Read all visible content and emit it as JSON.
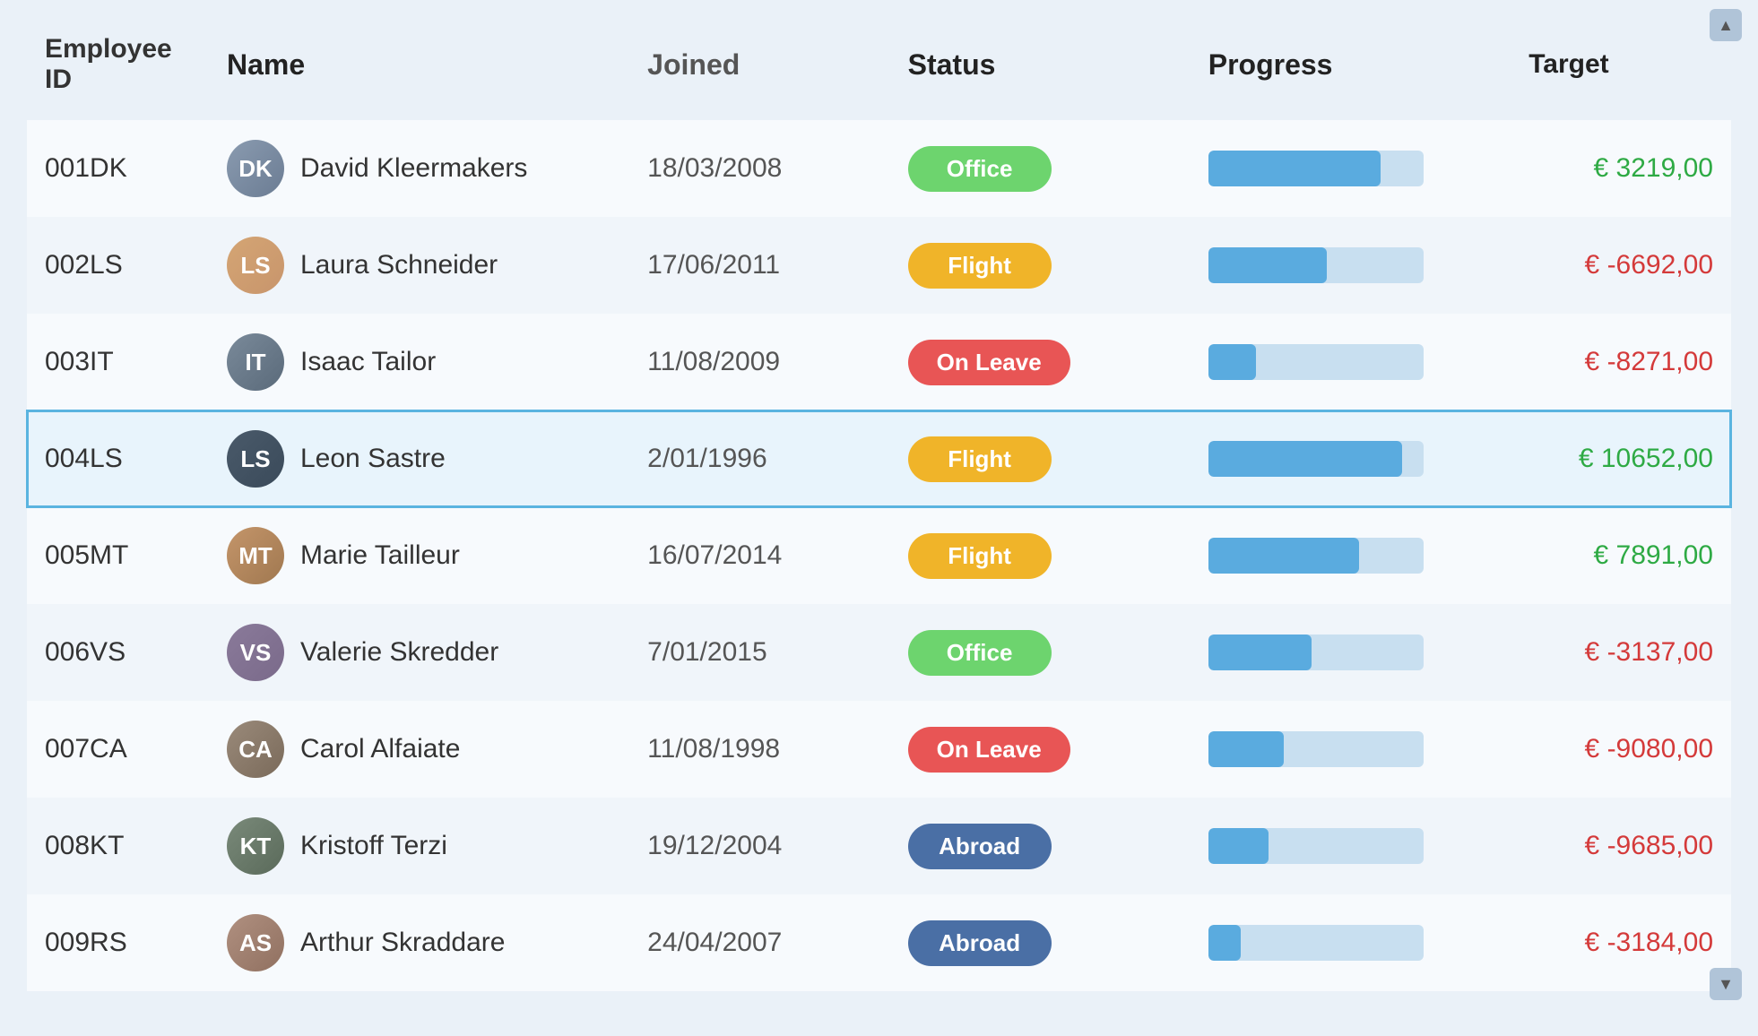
{
  "table": {
    "columns": [
      {
        "key": "id",
        "label": "Employee ID"
      },
      {
        "key": "name",
        "label": "Name"
      },
      {
        "key": "joined",
        "label": "Joined"
      },
      {
        "key": "status",
        "label": "Status"
      },
      {
        "key": "progress",
        "label": "Progress"
      },
      {
        "key": "target",
        "label": "Target"
      }
    ],
    "rows": [
      {
        "id": "001DK",
        "name": "David Kleermakers",
        "avatar_class": "male-1",
        "avatar_initials": "DK",
        "joined": "18/03/2008",
        "status": "Office",
        "status_class": "status-office",
        "progress": 80,
        "target": "€ 3219,00",
        "target_class": "target-positive",
        "selected": false
      },
      {
        "id": "002LS",
        "name": "Laura Schneider",
        "avatar_class": "female-1",
        "avatar_initials": "LS",
        "joined": "17/06/2011",
        "status": "Flight",
        "status_class": "status-flight",
        "progress": 55,
        "target": "€ -6692,00",
        "target_class": "target-negative",
        "selected": false
      },
      {
        "id": "003IT",
        "name": "Isaac Tailor",
        "avatar_class": "male-2",
        "avatar_initials": "IT",
        "joined": "11/08/2009",
        "status": "On Leave",
        "status_class": "status-on-leave",
        "progress": 22,
        "target": "€ -8271,00",
        "target_class": "target-negative",
        "selected": false
      },
      {
        "id": "004LS",
        "name": "Leon Sastre",
        "avatar_class": "male-3",
        "avatar_initials": "LS",
        "joined": "2/01/1996",
        "status": "Flight",
        "status_class": "status-flight",
        "progress": 90,
        "target": "€ 10652,00",
        "target_class": "target-positive",
        "selected": true
      },
      {
        "id": "005MT",
        "name": "Marie Tailleur",
        "avatar_class": "female-2",
        "avatar_initials": "MT",
        "joined": "16/07/2014",
        "status": "Flight",
        "status_class": "status-flight",
        "progress": 70,
        "target": "€ 7891,00",
        "target_class": "target-positive",
        "selected": false
      },
      {
        "id": "006VS",
        "name": "Valerie Skredder",
        "avatar_class": "female-3",
        "avatar_initials": "VS",
        "joined": "7/01/2015",
        "status": "Office",
        "status_class": "status-office",
        "progress": 48,
        "target": "€ -3137,00",
        "target_class": "target-negative",
        "selected": false
      },
      {
        "id": "007CA",
        "name": "Carol Alfaiate",
        "avatar_class": "female-4",
        "avatar_initials": "CA",
        "joined": "11/08/1998",
        "status": "On Leave",
        "status_class": "status-on-leave",
        "progress": 35,
        "target": "€ -9080,00",
        "target_class": "target-negative",
        "selected": false
      },
      {
        "id": "008KT",
        "name": "Kristoff Terzi",
        "avatar_class": "male-4",
        "avatar_initials": "KT",
        "joined": "19/12/2004",
        "status": "Abroad",
        "status_class": "status-abroad",
        "progress": 28,
        "target": "€ -9685,00",
        "target_class": "target-negative",
        "selected": false
      },
      {
        "id": "009RS",
        "name": "Arthur Skraddare",
        "avatar_class": "female-5",
        "avatar_initials": "AS",
        "joined": "24/04/2007",
        "status": "Abroad",
        "status_class": "status-abroad",
        "progress": 15,
        "target": "€ -3184,00",
        "target_class": "target-negative",
        "selected": false
      }
    ],
    "scroll_up_label": "▲",
    "scroll_down_label": "▼"
  }
}
